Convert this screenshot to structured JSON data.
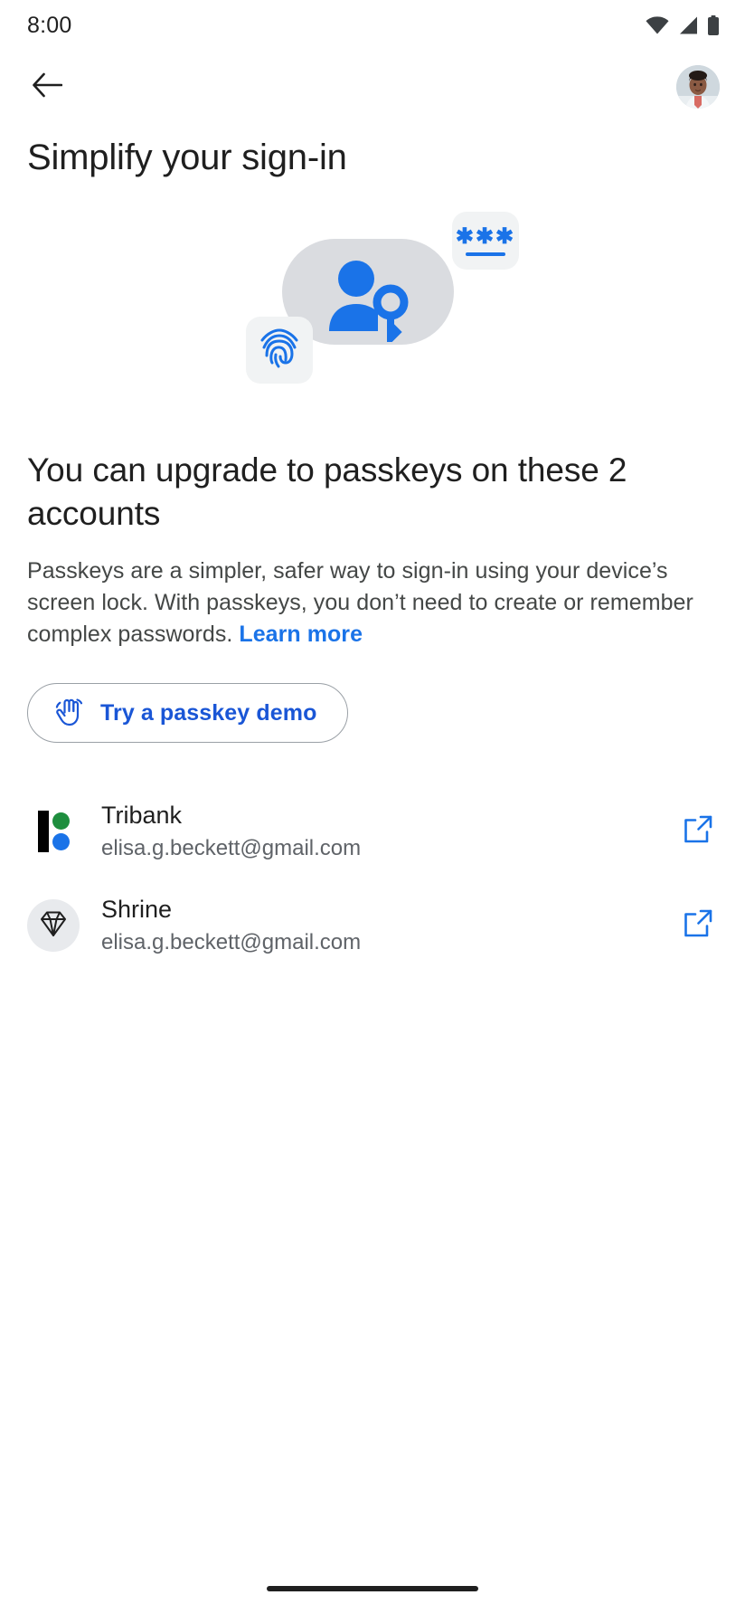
{
  "status_bar": {
    "time": "8:00",
    "icons": [
      "wifi-icon",
      "cellular-signal-icon",
      "battery-icon"
    ]
  },
  "app_bar": {
    "back_icon": "back-arrow-icon",
    "avatar": "account-avatar"
  },
  "header": {
    "page_title": "Simplify your sign-in"
  },
  "illustration": {
    "person_key_icon": "person-with-key-icon",
    "password_card": {
      "masked_value": "✱✱✱",
      "icon": "password-card-icon"
    },
    "fingerprint_card": {
      "icon": "fingerprint-icon"
    }
  },
  "main": {
    "headline": "You can upgrade to passkeys on these 2 accounts",
    "body_text": "Passkeys are a simpler, safer way to sign-in using your device’s screen lock. With passkeys, you don’t need to create or remember complex passwords. ",
    "learn_more_label": "Learn more",
    "demo_button": {
      "label": "Try a passkey demo",
      "icon": "touch-hand-icon"
    }
  },
  "accounts": [
    {
      "name": "Tribank",
      "email": "elisa.g.beckett@gmail.com",
      "logo": "tribank-logo",
      "action_icon": "open-in-new-icon"
    },
    {
      "name": "Shrine",
      "email": "elisa.g.beckett@gmail.com",
      "logo": "shrine-diamond-logo",
      "action_icon": "open-in-new-icon"
    }
  ],
  "nav_bar": {
    "handle": "home-gesture-handle"
  },
  "colors": {
    "accent_blue": "#1a73e8",
    "link_blue": "#1a56d6",
    "text_primary": "#1f1f1f",
    "text_secondary": "#5f6368",
    "surface_gray": "#f1f3f4",
    "blob_gray": "#dadce0",
    "tribank_green": "#1e8e3e"
  }
}
